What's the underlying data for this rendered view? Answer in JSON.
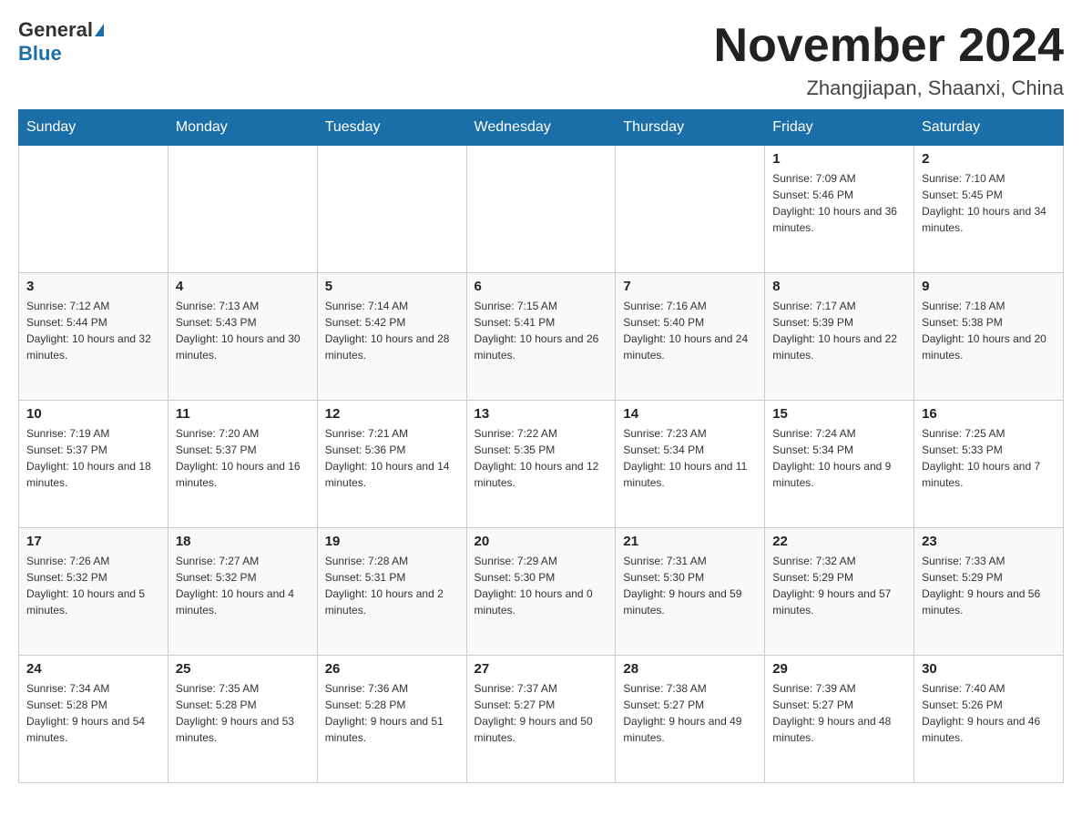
{
  "header": {
    "logo_general": "General",
    "logo_blue": "Blue",
    "month_title": "November 2024",
    "location": "Zhangjiapan, Shaanxi, China"
  },
  "days_of_week": [
    "Sunday",
    "Monday",
    "Tuesday",
    "Wednesday",
    "Thursday",
    "Friday",
    "Saturday"
  ],
  "weeks": [
    [
      {
        "day": "",
        "info": ""
      },
      {
        "day": "",
        "info": ""
      },
      {
        "day": "",
        "info": ""
      },
      {
        "day": "",
        "info": ""
      },
      {
        "day": "",
        "info": ""
      },
      {
        "day": "1",
        "info": "Sunrise: 7:09 AM\nSunset: 5:46 PM\nDaylight: 10 hours and 36 minutes."
      },
      {
        "day": "2",
        "info": "Sunrise: 7:10 AM\nSunset: 5:45 PM\nDaylight: 10 hours and 34 minutes."
      }
    ],
    [
      {
        "day": "3",
        "info": "Sunrise: 7:12 AM\nSunset: 5:44 PM\nDaylight: 10 hours and 32 minutes."
      },
      {
        "day": "4",
        "info": "Sunrise: 7:13 AM\nSunset: 5:43 PM\nDaylight: 10 hours and 30 minutes."
      },
      {
        "day": "5",
        "info": "Sunrise: 7:14 AM\nSunset: 5:42 PM\nDaylight: 10 hours and 28 minutes."
      },
      {
        "day": "6",
        "info": "Sunrise: 7:15 AM\nSunset: 5:41 PM\nDaylight: 10 hours and 26 minutes."
      },
      {
        "day": "7",
        "info": "Sunrise: 7:16 AM\nSunset: 5:40 PM\nDaylight: 10 hours and 24 minutes."
      },
      {
        "day": "8",
        "info": "Sunrise: 7:17 AM\nSunset: 5:39 PM\nDaylight: 10 hours and 22 minutes."
      },
      {
        "day": "9",
        "info": "Sunrise: 7:18 AM\nSunset: 5:38 PM\nDaylight: 10 hours and 20 minutes."
      }
    ],
    [
      {
        "day": "10",
        "info": "Sunrise: 7:19 AM\nSunset: 5:37 PM\nDaylight: 10 hours and 18 minutes."
      },
      {
        "day": "11",
        "info": "Sunrise: 7:20 AM\nSunset: 5:37 PM\nDaylight: 10 hours and 16 minutes."
      },
      {
        "day": "12",
        "info": "Sunrise: 7:21 AM\nSunset: 5:36 PM\nDaylight: 10 hours and 14 minutes."
      },
      {
        "day": "13",
        "info": "Sunrise: 7:22 AM\nSunset: 5:35 PM\nDaylight: 10 hours and 12 minutes."
      },
      {
        "day": "14",
        "info": "Sunrise: 7:23 AM\nSunset: 5:34 PM\nDaylight: 10 hours and 11 minutes."
      },
      {
        "day": "15",
        "info": "Sunrise: 7:24 AM\nSunset: 5:34 PM\nDaylight: 10 hours and 9 minutes."
      },
      {
        "day": "16",
        "info": "Sunrise: 7:25 AM\nSunset: 5:33 PM\nDaylight: 10 hours and 7 minutes."
      }
    ],
    [
      {
        "day": "17",
        "info": "Sunrise: 7:26 AM\nSunset: 5:32 PM\nDaylight: 10 hours and 5 minutes."
      },
      {
        "day": "18",
        "info": "Sunrise: 7:27 AM\nSunset: 5:32 PM\nDaylight: 10 hours and 4 minutes."
      },
      {
        "day": "19",
        "info": "Sunrise: 7:28 AM\nSunset: 5:31 PM\nDaylight: 10 hours and 2 minutes."
      },
      {
        "day": "20",
        "info": "Sunrise: 7:29 AM\nSunset: 5:30 PM\nDaylight: 10 hours and 0 minutes."
      },
      {
        "day": "21",
        "info": "Sunrise: 7:31 AM\nSunset: 5:30 PM\nDaylight: 9 hours and 59 minutes."
      },
      {
        "day": "22",
        "info": "Sunrise: 7:32 AM\nSunset: 5:29 PM\nDaylight: 9 hours and 57 minutes."
      },
      {
        "day": "23",
        "info": "Sunrise: 7:33 AM\nSunset: 5:29 PM\nDaylight: 9 hours and 56 minutes."
      }
    ],
    [
      {
        "day": "24",
        "info": "Sunrise: 7:34 AM\nSunset: 5:28 PM\nDaylight: 9 hours and 54 minutes."
      },
      {
        "day": "25",
        "info": "Sunrise: 7:35 AM\nSunset: 5:28 PM\nDaylight: 9 hours and 53 minutes."
      },
      {
        "day": "26",
        "info": "Sunrise: 7:36 AM\nSunset: 5:28 PM\nDaylight: 9 hours and 51 minutes."
      },
      {
        "day": "27",
        "info": "Sunrise: 7:37 AM\nSunset: 5:27 PM\nDaylight: 9 hours and 50 minutes."
      },
      {
        "day": "28",
        "info": "Sunrise: 7:38 AM\nSunset: 5:27 PM\nDaylight: 9 hours and 49 minutes."
      },
      {
        "day": "29",
        "info": "Sunrise: 7:39 AM\nSunset: 5:27 PM\nDaylight: 9 hours and 48 minutes."
      },
      {
        "day": "30",
        "info": "Sunrise: 7:40 AM\nSunset: 5:26 PM\nDaylight: 9 hours and 46 minutes."
      }
    ]
  ]
}
